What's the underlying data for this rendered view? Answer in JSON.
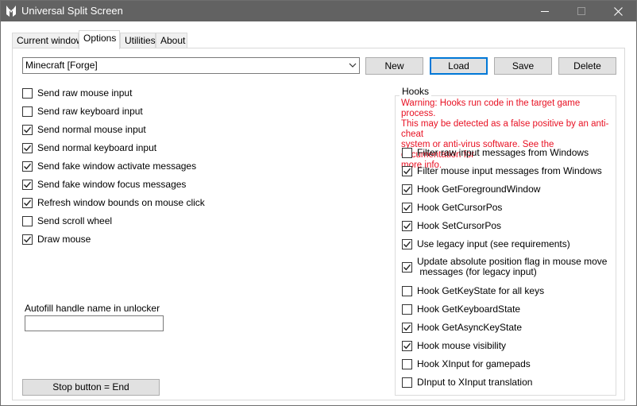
{
  "window": {
    "title": "Universal Split Screen"
  },
  "tabs": [
    {
      "label": "Current window"
    },
    {
      "label": "Options"
    },
    {
      "label": "Utilities"
    },
    {
      "label": "About"
    }
  ],
  "profile": {
    "selected": "Minecraft [Forge]"
  },
  "buttons": {
    "new": "New",
    "load": "Load",
    "save": "Save",
    "delete": "Delete",
    "stop": "Stop button = End"
  },
  "left_options": [
    {
      "label": "Send raw mouse input",
      "checked": false
    },
    {
      "label": "Send raw keyboard input",
      "checked": false
    },
    {
      "label": "Send normal mouse input",
      "checked": true
    },
    {
      "label": "Send normal keyboard input",
      "checked": true
    },
    {
      "label": "Send fake window activate messages",
      "checked": true
    },
    {
      "label": "Send fake window focus messages",
      "checked": true
    },
    {
      "label": "Refresh window bounds on mouse click",
      "checked": true
    },
    {
      "label": "Send scroll wheel",
      "checked": false
    },
    {
      "label": "Draw mouse",
      "checked": true
    }
  ],
  "autofill": {
    "label": "Autofill handle name in unlocker",
    "value": ""
  },
  "hooks": {
    "title": "Hooks",
    "warning_lines": [
      "Warning: Hooks run code in the target game process.",
      "This may be detected as a false positive by an anti-cheat",
      "system or anti-virus software. See the documentation for",
      "more info."
    ],
    "options": [
      {
        "label": "Filter raw input messages from Windows",
        "checked": false
      },
      {
        "label": "Filter mouse input messages from Windows",
        "checked": true
      },
      {
        "label": "Hook GetForegroundWindow",
        "checked": true
      },
      {
        "label": "Hook GetCursorPos",
        "checked": true
      },
      {
        "label": "Hook SetCursorPos",
        "checked": true
      },
      {
        "label": "Use legacy input (see requirements)",
        "checked": true
      },
      {
        "label_lines": [
          "Update absolute position flag in mouse move",
          " messages (for legacy input)"
        ],
        "checked": true
      },
      {
        "label": "Hook GetKeyState for all keys",
        "checked": false
      },
      {
        "label": "Hook GetKeyboardState",
        "checked": false
      },
      {
        "label": "Hook GetAsyncKeyState",
        "checked": true
      },
      {
        "label": "Hook mouse visibility",
        "checked": true
      },
      {
        "label": "Hook XInput for gamepads",
        "checked": false
      },
      {
        "label": "DInput to XInput translation",
        "checked": false
      }
    ]
  },
  "colors": {
    "titlebar": "#626262",
    "warning": "#e81123",
    "accent": "#0078d7"
  }
}
